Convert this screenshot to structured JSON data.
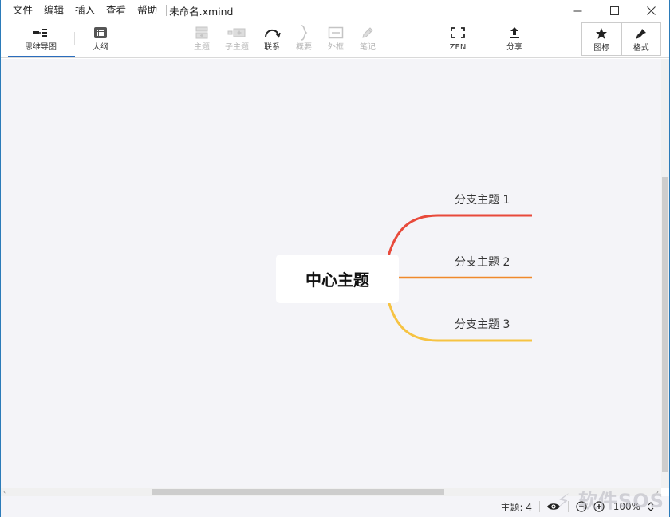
{
  "menu": {
    "items": [
      "文件",
      "编辑",
      "插入",
      "查看",
      "帮助"
    ],
    "doc_title": "未命名.xmind"
  },
  "toolbar": {
    "views": [
      {
        "label": "思维导图",
        "icon": "mindmap-icon",
        "active": true
      },
      {
        "label": "大纲",
        "icon": "outline-list-icon",
        "active": false
      }
    ],
    "insert": [
      {
        "label": "主题",
        "icon": "topic-icon",
        "enabled": false
      },
      {
        "label": "子主题",
        "icon": "subtopic-icon",
        "enabled": false
      },
      {
        "label": "联系",
        "icon": "relationship-icon",
        "enabled": true
      },
      {
        "label": "概要",
        "icon": "summary-brace-icon",
        "enabled": false
      },
      {
        "label": "外框",
        "icon": "boundary-icon",
        "enabled": false
      },
      {
        "label": "笔记",
        "icon": "note-pen-icon",
        "enabled": false
      }
    ],
    "zen_label": "ZEN",
    "share_label": "分享",
    "panel": [
      {
        "label": "图标",
        "icon": "star-icon"
      },
      {
        "label": "格式",
        "icon": "format-brush-icon"
      }
    ]
  },
  "map": {
    "central_topic": "中心主题",
    "branches": [
      {
        "label": "分支主题 1",
        "color": "#e84a3b"
      },
      {
        "label": "分支主题 2",
        "color": "#f0892c"
      },
      {
        "label": "分支主题 3",
        "color": "#f6c343"
      }
    ]
  },
  "status": {
    "topic_count": "主题: 4",
    "zoom": "100%"
  },
  "watermark": "软件SOS",
  "colors": {
    "accent": "#2a6dbd",
    "canvas_bg": "#f4f4f8",
    "window_border": "#2b7bb9"
  }
}
